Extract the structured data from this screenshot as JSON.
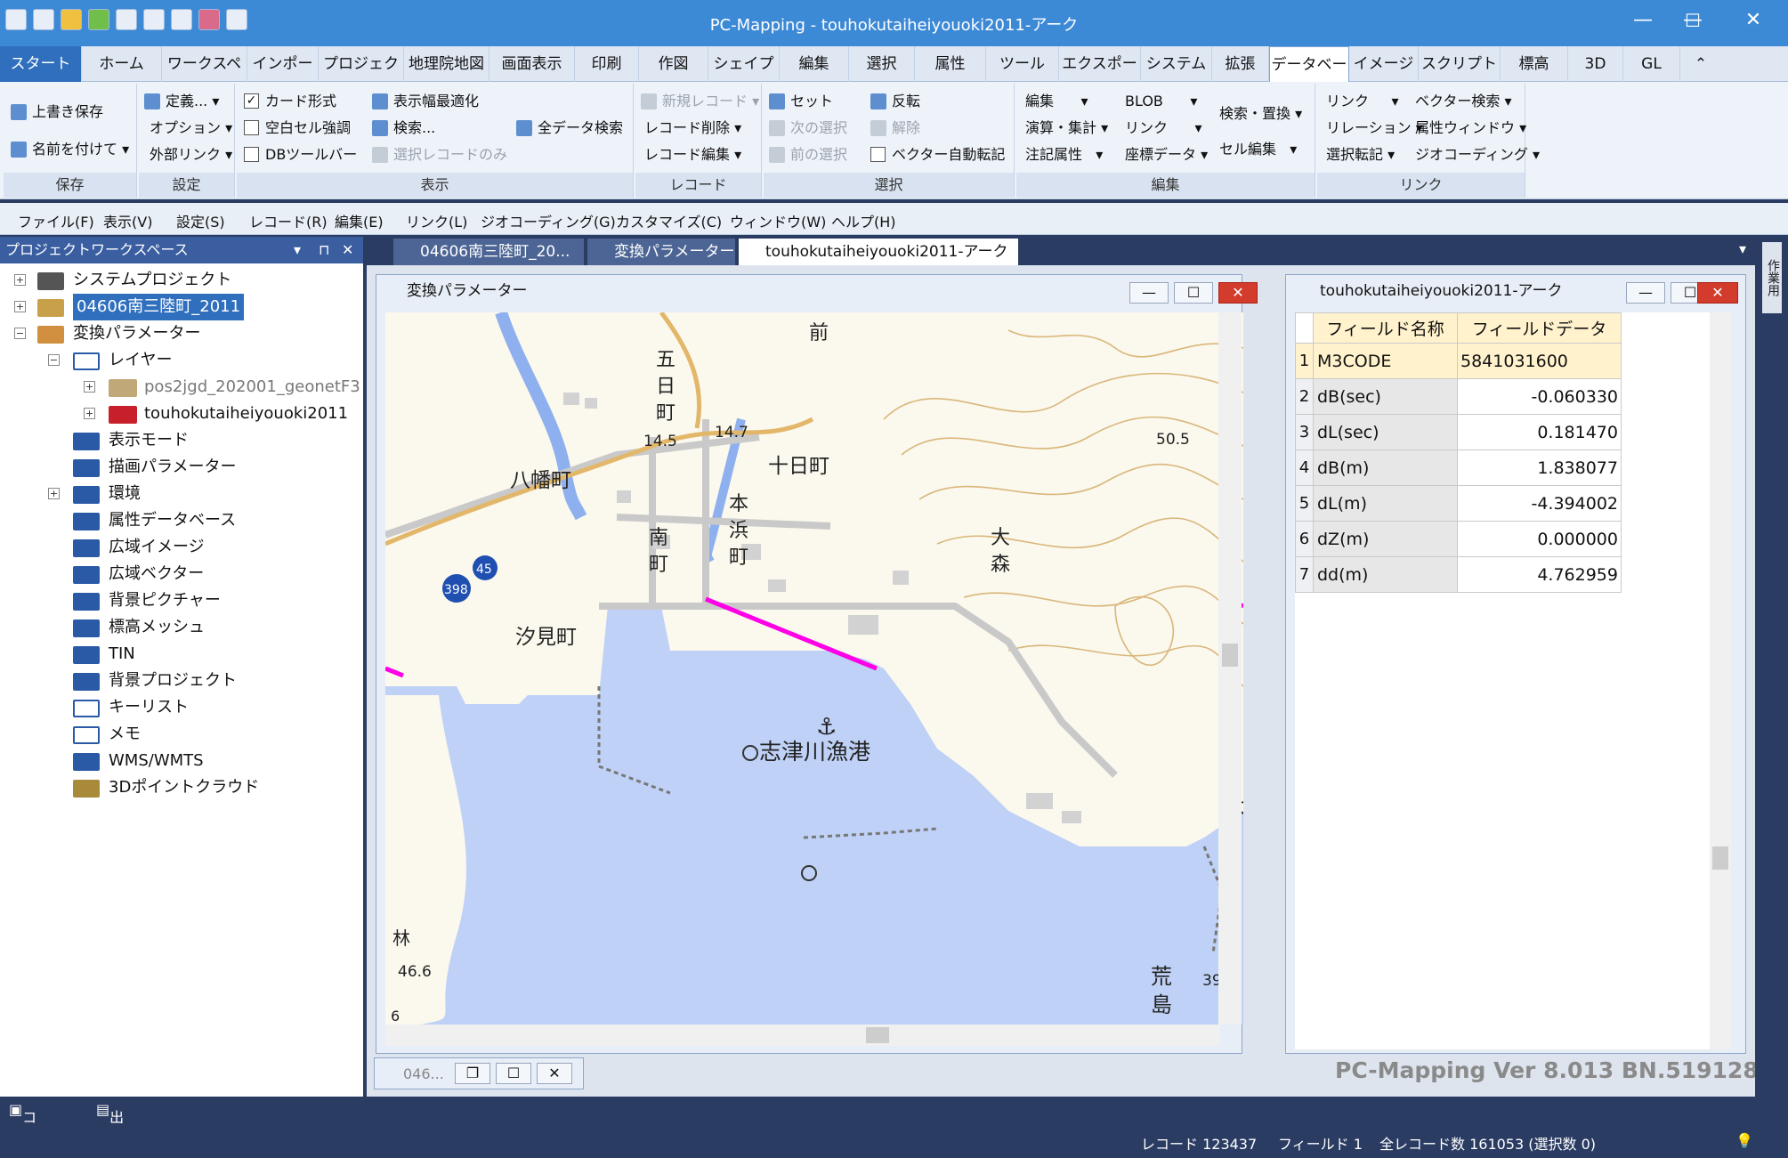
{
  "window": {
    "title": "PC-Mapping - touhokutaiheiyouoki2011-アーク"
  },
  "ribbon_tabs": [
    "スタート",
    "ホーム",
    "ワークスペース",
    "インポート",
    "プロジェクト",
    "地理院地図",
    "画面表示",
    "印刷",
    "作図",
    "シェイプ",
    "編集",
    "選択",
    "属性",
    "ツール",
    "エクスポート",
    "システム",
    "拡張",
    "データベース",
    "イメージ",
    "スクリプト",
    "標高",
    "3D",
    "GL"
  ],
  "ribbon": {
    "save": {
      "label": "保存",
      "overwrite": "上書き保存",
      "save_as": "名前を付けて"
    },
    "settings": {
      "label": "設定",
      "define": "定義...",
      "options": "オプション",
      "external_link": "外部リンク"
    },
    "display": {
      "label": "表示",
      "card": "カード形式",
      "blank_cell": "空白セル強調",
      "db_toolbar": "DBツールバー",
      "fit_width": "表示幅最適化",
      "search": "検索...",
      "selected_only": "選択レコードのみ",
      "search_all": "全データ検索"
    },
    "record": {
      "label": "レコード",
      "new": "新規レコード",
      "delete": "レコード削除",
      "edit": "レコード編集"
    },
    "select": {
      "label": "選択",
      "set": "セット",
      "next": "次の選択",
      "prev": "前の選択",
      "invert": "反転",
      "release": "解除",
      "vector_auto": "ベクター自動転記"
    },
    "edit": {
      "label": "編集",
      "edit": "編集",
      "calc": "演算・集計",
      "annotation": "注記属性",
      "blob": "BLOB",
      "link": "リンク",
      "coord_data": "座標データ",
      "search_replace": "検索・置換",
      "cell_edit": "セル編集"
    },
    "link": {
      "label": "リンク",
      "link": "リンク",
      "relation": "リレーション",
      "select_transfer": "選択転記",
      "vector_search": "ベクター検索",
      "attr_window": "属性ウィンドウ",
      "geocoding": "ジオコーディング"
    }
  },
  "menu": [
    "ファイル(F)",
    "表示(V)",
    "設定(S)",
    "レコード(R)",
    "編集(E)",
    "リンク(L)",
    "ジオコーディング(G)",
    "カスタマイズ(C)",
    "ウィンドウ(W)",
    "ヘルプ(H)"
  ],
  "workspace": {
    "title": "プロジェクトワークスペース",
    "pin": "⊓",
    "close": "✕",
    "tree": {
      "system_project": "システムプロジェクト",
      "project": "04606南三陸町_2011",
      "conv": "変換パラメーター",
      "layer": "レイヤー",
      "layer_item1": "pos2jgd_202001_geonetF3",
      "layer_item2": "touhokutaiheiyouoki2011",
      "display_mode": "表示モード",
      "draw_param": "描画パラメーター",
      "environment": "環境",
      "attr_db": "属性データベース",
      "wide_image": "広域イメージ",
      "wide_vector": "広域ベクター",
      "bg_picture": "背景ピクチャー",
      "elev_mesh": "標高メッシュ",
      "tin": "TIN",
      "bg_project": "背景プロジェクト",
      "key_list": "キーリスト",
      "memo": "メモ",
      "wms": "WMS/WMTS",
      "pointcloud": "3Dポイントクラウド"
    }
  },
  "doc_tabs": {
    "tab1": "04606南三陸町_20...",
    "tab2": "変換パラメーター",
    "tab3": "touhokutaiheiyouoki2011-アーク",
    "close": "✕"
  },
  "map_window": {
    "title": "変換パラメーター"
  },
  "map_labels": {
    "mae": "前",
    "go": "五",
    "hi": "日",
    "machi": "町",
    "h145": "14.5",
    "h147": "14.7",
    "h505": "50.5",
    "tokamachi": "十日町",
    "hachiman": "八幡町",
    "hon": "本",
    "hama": "浜",
    "machi2": "町",
    "minami": "南",
    "machi3": "町",
    "oo": "大",
    "mori": "森",
    "shiomi": "汐見町",
    "port": "志津川漁港",
    "hayashi": "林",
    "h466": "46.6",
    "ara": "荒",
    "shima": "島",
    "h39": "39",
    "dai": "大",
    "six": "6",
    "r45": "45",
    "r398": "398"
  },
  "attr_window": {
    "title": "touhokutaiheiyouoki2011-アーク",
    "col_name": "フィールド名称",
    "col_data": "フィールドデータ",
    "rows": [
      {
        "i": "1",
        "k": "M3CODE",
        "v": "5841031600"
      },
      {
        "i": "2",
        "k": "dB(sec)",
        "v": "-0.060330"
      },
      {
        "i": "3",
        "k": "dL(sec)",
        "v": "0.181470"
      },
      {
        "i": "4",
        "k": "dB(m)",
        "v": "1.838077"
      },
      {
        "i": "5",
        "k": "dL(m)",
        "v": "-4.394002"
      },
      {
        "i": "6",
        "k": "dZ(m)",
        "v": "0.000000"
      },
      {
        "i": "7",
        "k": "dd(m)",
        "v": "4.762959"
      }
    ]
  },
  "minimized": {
    "label": "046..."
  },
  "version": "PC-Mapping Ver 8.013 BN.519128",
  "bottom": {
    "command": "コマンド",
    "output": "出力"
  },
  "status": {
    "record": "レコード 123437",
    "field": "フィールド 1",
    "total": "全レコード数 161053 (選択数 0)"
  },
  "side_label": "作業用"
}
